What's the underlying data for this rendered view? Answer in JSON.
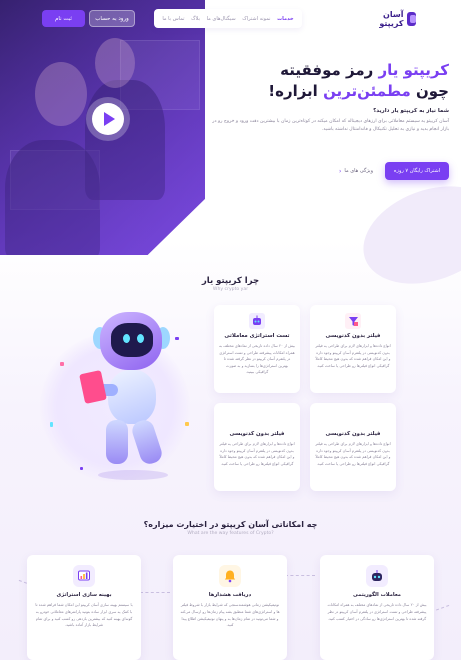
{
  "nav": {
    "logo_text": "آسان کریپتو",
    "menu": [
      "خدمات",
      "نمونه اشتراک",
      "سیگنال‌های ما",
      "بلاگ",
      "تماس با ما"
    ],
    "login_label": "ورود به حساب",
    "signup_label": "ثبت نام"
  },
  "hero": {
    "title_line1_a": "کریپتو یار",
    "title_line1_b": "رمز موفقیته",
    "title_line2_a": "چون",
    "title_line2_b": "مطمئن‌ترین",
    "title_line2_c": "ابزاره!",
    "question": "شما نیاز به کریپتو یار دارید؟",
    "description": "آسان کریپتو یه سیستم معاملاتی برای ارزهای دیجیتاله که امکان میکنه در کوتاه‌ترین زمان با بیشترین دقت ورود و خروج رو در بازار انجام بدید و نیازی به تحلیل تکنیکال و فاندامنتال نداشته باشید.",
    "cta_label": "اشتراک رایگان ۷ روزه",
    "features_link": "ویژگی های ما"
  },
  "why": {
    "title": "چرا کریپتو یار",
    "subtitle": "Why crypto yar",
    "cards": [
      {
        "title": "فیلتر بدون کدنویسی",
        "text": "انواع داده‌ها و ابزارهای لازم برای طراحی یه فیلتر بدون کدنویسی در پلتفرم آسان کریپتو وجود داره و این امکان فراهم شده که بدون هیچ محیط کاملاً گرافیکی انواع فیلترها رو طراحی یا ساخت کنید."
      },
      {
        "title": "تست استراتژی معاملاتی",
        "text": "بیش از ۲۰ سال داده تاریخی از نمادهای مختلف به همراه امکانات پیشرفته طراحی و تست استراتژی در پلتفرم آسان کریپتو در نظر گرفته شده تا بهترین استراتژی‌ها را بسازید و به صورت گرافیکی ببینید."
      },
      {
        "title": "فیلتر بدون کدنویسی",
        "text": "انواع داده‌ها و ابزارهای لازم برای طراحی یه فیلتر بدون کدنویسی در پلتفرم آسان کریپتو وجود داره و این امکان فراهم شده که بدون هیچ محیط کاملاً گرافیکی انواع فیلترها رو طراحی یا ساخت کنید."
      },
      {
        "title": "فیلتر بدون کدنویسی",
        "text": "انواع داده‌ها و ابزارهای لازم برای طراحی یه فیلتر بدون کدنویسی در پلتفرم آسان کریپتو وجود داره و این امکان فراهم شده که بدون هیچ محیط کاملاً گرافیکی انواع فیلترها رو طراحی یا ساخت کنید."
      }
    ]
  },
  "capabilities": {
    "title": "چه امکاناتی آسان کریپتو در اختیارت میزاره؟",
    "subtitle": "What are the way features of Crypto?",
    "cards": [
      {
        "title": "معاملات الگوریتمی",
        "text": "بیش از ۲۰ سال داده تاریخی از نمادهای مختلف به همراه امکانات پیشرفته طراحی و تست استراتژی در پلتفرم آسان کریپتو در نظر گرفته شده تا بهترین استراتژی‌ها رو سادگی در اختیار کسب کنید."
      },
      {
        "title": "دریافت هشدارها",
        "text": "نوتیفیکیشن زمانی هوشمندسنجی که شرایط بازار با شروط فیلتر ها و استراتژی‌های شما منطبق بشه پیام زمان‌ها رو ارسال می‌کنه و شما می‌تونید در تمام زمان‌ها به و پنهان نوتیفیکیشن اطلاع پیدا کنید."
      },
      {
        "title": "بهینه سازی استراتژی",
        "text": "با سیستم بهینه سازی آسان کریپتو این امکان شما فراهم شده تا با کمک یه سری ابزار ساده بتونید پارامترهای معاملاتی خودرو به گونه‌ای بهینه کنید که بیشترین بازدهی رو کسب کنید و برای تمام شرایط بازار آماده باشید."
      }
    ]
  },
  "colors": {
    "accent": "#7a3ff2",
    "dark_text": "#2b2340",
    "muted_text": "#8a849a"
  }
}
